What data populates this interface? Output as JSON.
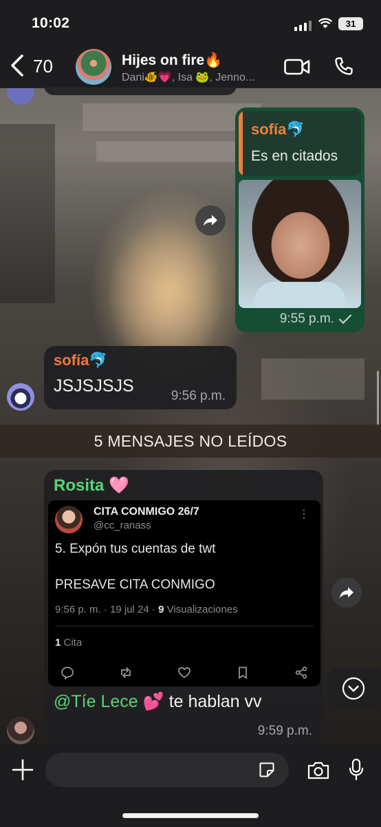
{
  "status_bar": {
    "time": "10:02",
    "battery": "31"
  },
  "header": {
    "back_count": "70",
    "group_name": "Hijes on fire🔥",
    "members": "Dani🐠💗, Isa 🐸, Jenno..."
  },
  "messages": {
    "outgoing": {
      "quote_author": "sofía🐬",
      "quote_text": "Es en citados",
      "time": "9:55 p.m."
    },
    "sofia": {
      "sender": "sofía🐬",
      "text": "JSJSJSJS",
      "time": "9:56 p.m."
    },
    "unread_divider": "5 MENSAJES NO LEÍDOS",
    "rosita": {
      "sender": "Rosita 🩷",
      "tweet": {
        "name": "CITA CONMIGO 26/7",
        "handle": "@cc_ranass",
        "line1": "5. Expón tus cuentas de twt",
        "line2": "PRESAVE CITA CONMIGO",
        "date": "9:56 p. m. · 19 jul 24 · ",
        "views_count": "9",
        "views_label": " Visualizaciones",
        "quotes_count": "1",
        "quotes_label": " Cita"
      },
      "mention": "@Tíe Lece",
      "mention_emoji": "💕",
      "text_after": " te hablan vv",
      "time": "9:59 p.m."
    }
  },
  "input": {
    "placeholder": ""
  },
  "colors": {
    "outgoing_bubble": "#154d35",
    "quote_accent": "#f07c3a",
    "sender_orange": "#f07a39",
    "sender_green": "#56d47a"
  }
}
